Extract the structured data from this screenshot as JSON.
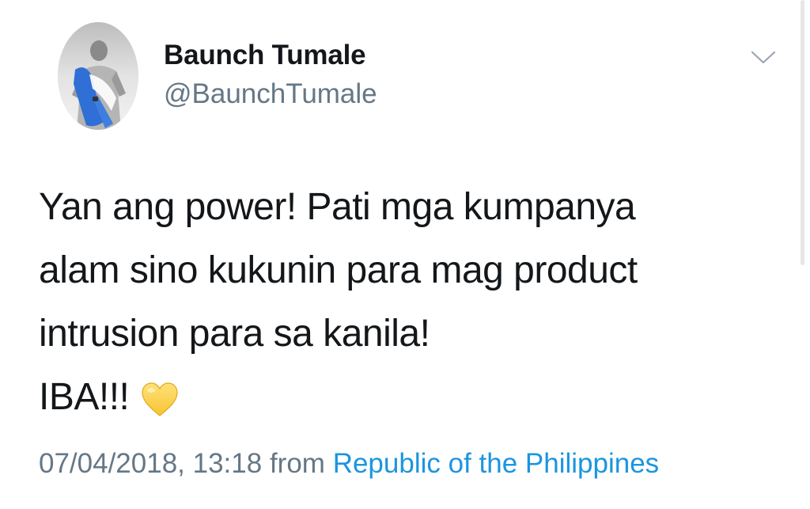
{
  "user": {
    "display_name": "Baunch Tumale",
    "handle": "@BaunchTumale",
    "avatar_icon": "profile-photo"
  },
  "tweet": {
    "lines": [
      "Yan ang power! Pati mga kumpanya",
      "alam sino kukunin para mag product",
      "intrusion para sa kanila!",
      "IBA!!!"
    ],
    "emoji_icon": "yellow-heart-icon",
    "timestamp": "07/04/2018, 13:18",
    "from_label": "from",
    "source": "Republic of the Philippines"
  },
  "colors": {
    "text": "#14171a",
    "secondary": "#657786",
    "link": "#1b95e0",
    "heart": "#ffd45a"
  }
}
